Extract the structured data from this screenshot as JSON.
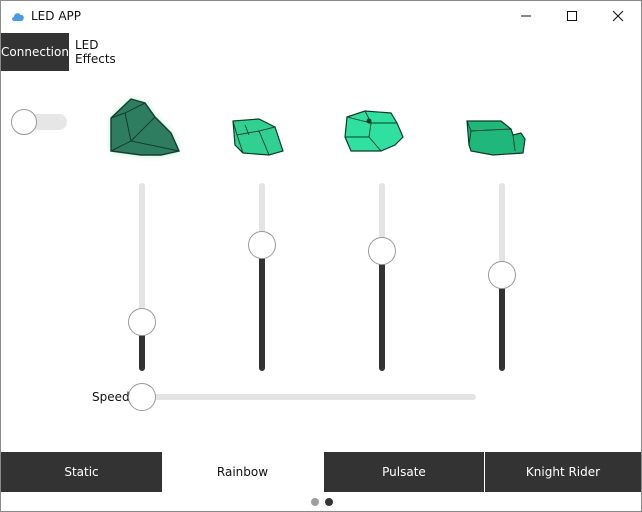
{
  "window": {
    "title": "LED APP",
    "icon": "cloud-icon",
    "controls": [
      "minimize-icon",
      "maximize-icon",
      "close-icon"
    ]
  },
  "tabs": [
    {
      "label": "Connection",
      "active": true
    },
    {
      "label": "LED Effects",
      "active": false
    }
  ],
  "power_toggle": {
    "on": false
  },
  "leds": [
    {
      "name": "gem-1",
      "color": "#2e7d60",
      "glow": true,
      "level": 0.26
    },
    {
      "name": "gem-2",
      "color": "#2fd090",
      "glow": false,
      "level": 0.67
    },
    {
      "name": "gem-3",
      "color": "#2fe0a0",
      "glow": false,
      "level": 0.64
    },
    {
      "name": "gem-4",
      "color": "#1fb87a",
      "glow": false,
      "level": 0.51
    }
  ],
  "speed": {
    "label": "Speed",
    "level": 0.0
  },
  "effects": [
    {
      "label": "Static",
      "selected": false
    },
    {
      "label": "Rainbow",
      "selected": true
    },
    {
      "label": "Pulsate",
      "selected": false
    },
    {
      "label": "Knight Rider",
      "selected": false
    }
  ],
  "page_indicator": {
    "pages": 2,
    "current": 2
  },
  "colors": {
    "dark": "#333333",
    "rail": "#e4e4e4",
    "dot_inactive": "#9e9e9e",
    "dot_active": "#333333"
  }
}
